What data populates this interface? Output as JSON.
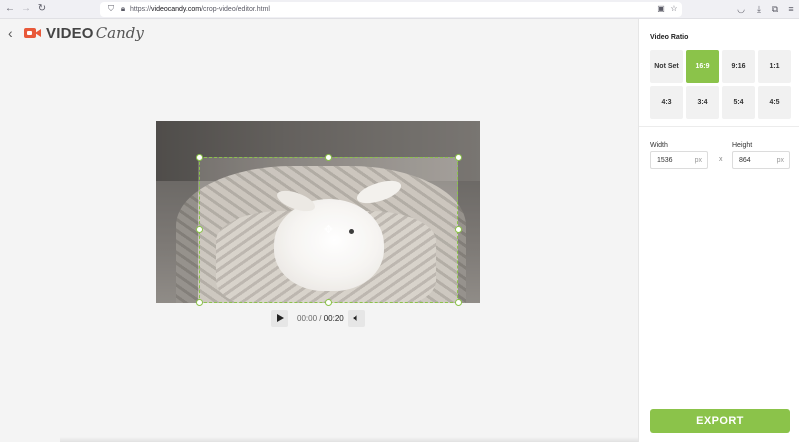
{
  "browser": {
    "url_prefix": "https://",
    "url_host": "videocandy.com",
    "url_path": "/crop-video/editor.html",
    "icons": [
      "back-icon",
      "forward-icon",
      "reload-icon",
      "shield-icon",
      "lock-icon",
      "picture-icon",
      "star-icon",
      "pocket-icon",
      "download-icon",
      "extensions-icon",
      "menu-icon"
    ]
  },
  "header": {
    "logo_part1": "VIDEO",
    "logo_part2": "Candy",
    "brand_color": "#e8593a"
  },
  "player": {
    "current_time": "00:00",
    "separator": " / ",
    "total_time": "00:20"
  },
  "panel": {
    "ratio_title": "Video Ratio",
    "ratios": [
      {
        "label": "Not Set",
        "active": false
      },
      {
        "label": "16:9",
        "active": true
      },
      {
        "label": "9:16",
        "active": false
      },
      {
        "label": "1:1",
        "active": false
      },
      {
        "label": "4:3",
        "active": false
      },
      {
        "label": "3:4",
        "active": false
      },
      {
        "label": "5:4",
        "active": false
      },
      {
        "label": "4:5",
        "active": false
      }
    ],
    "width_label": "Width",
    "width_value": "1536",
    "width_unit": "px",
    "times": "x",
    "height_label": "Height",
    "height_value": "864",
    "height_unit": "px",
    "export_label": "EXPORT",
    "accent_color": "#8bc34a"
  }
}
